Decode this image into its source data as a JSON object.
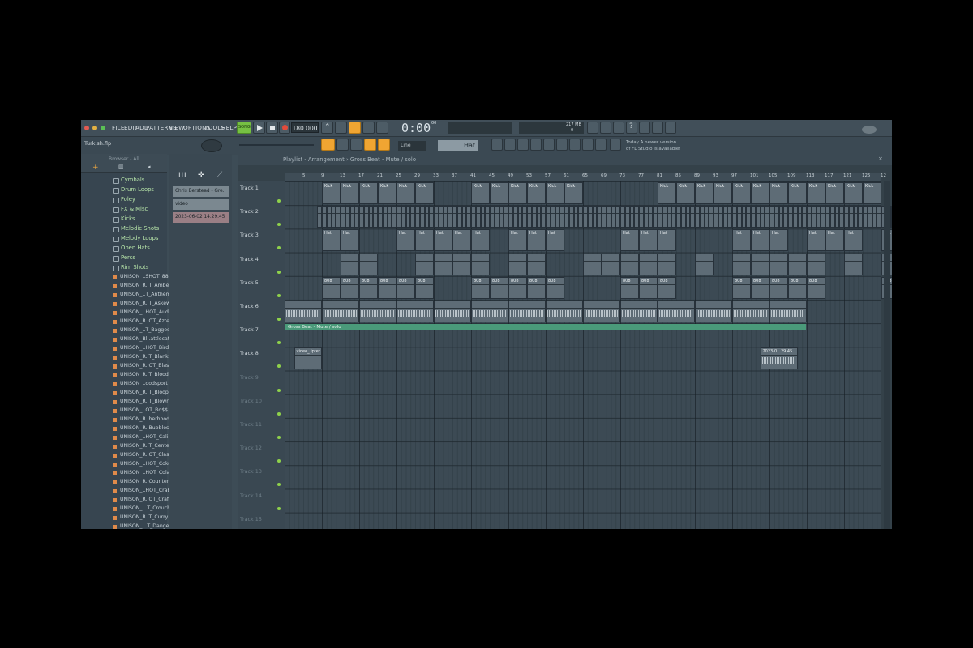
{
  "window": {
    "filename": "Turkish.flp"
  },
  "menu": [
    "FILE",
    "EDIT",
    "ADD",
    "PATTERNS",
    "VIEW",
    "OPTIONS",
    "TOOLS",
    "HELP"
  ],
  "transport": {
    "mode": "SONG",
    "tempo": "180.000",
    "time": "0:00",
    "time_small": "00",
    "memory": "217 MB",
    "cpu": "0"
  },
  "toolbar2": {
    "snap": "Line",
    "pattern": "Hat"
  },
  "news": {
    "line1": "Today  A newer version",
    "line2": "of FL Studio is available!"
  },
  "browser": {
    "label": "Browser - All",
    "folders": [
      "Cymbals",
      "Drum Loops",
      "Foley",
      "FX & Misc",
      "Kicks",
      "Melodic Shots",
      "Melody Loops",
      "Open Hats",
      "Percs",
      "Rim Shots"
    ],
    "files": [
      "UNISON_..SHOT_88",
      "UNISON_R..T_Amber",
      "UNISON_..T_Anthem",
      "UNISON_R..T_Askew",
      "UNISON_..HOT_Audi",
      "UNISON_R..OT_Aztec",
      "UNISON_..T_Bagged",
      "UNISON_Bl..attlecat",
      "UNISON_..HOT_Bird",
      "UNISON_R..T_Blank",
      "UNISON_R..OT_Blast",
      "UNISON_R..T_Blood",
      "UNISON_..oodsport",
      "UNISON_R..T_Bloop",
      "UNISON_R..T_Blown",
      "UNISON_..OT_Bo$$",
      "UNISON_R..herhood",
      "UNISON_R..Bubbles",
      "UNISON_..HOT_Cali",
      "UNISON_R..T_Center",
      "UNISON_R..OT_Class",
      "UNISON_..HOT_Coke",
      "UNISON_..HOT_Cola",
      "UNISON_R..Counters",
      "UNISON_..HOT_Crab",
      "UNISON_R..OT_Craft",
      "UNISON_...T_Crouch",
      "UNISON_R..T_Curry",
      "UNISON_...T_Danger"
    ]
  },
  "channels": [
    "Chris Berstead - Gre..",
    "video",
    "2023-06-02 14.29.45"
  ],
  "playlist": {
    "breadcrumb": "Playlist - Arrangement › Gross Beat - Mute / solo",
    "ruler": [
      "5",
      "9",
      "13",
      "17",
      "21",
      "25",
      "29",
      "33",
      "37",
      "41",
      "45",
      "49",
      "53",
      "57",
      "61",
      "65",
      "69",
      "73",
      "77",
      "81",
      "85",
      "89",
      "93",
      "97",
      "101",
      "105",
      "109",
      "113",
      "117",
      "121",
      "125",
      "12"
    ],
    "tracks": [
      "Track 1",
      "Track 2",
      "Track 3",
      "Track 4",
      "Track 5",
      "Track 6",
      "Track 7",
      "Track 8",
      "Track 9",
      "Track 10",
      "Track 11",
      "Track 12",
      "Track 13",
      "Track 14",
      "Track 15"
    ],
    "clip_labels": {
      "kick": "Kick",
      "hat": "Hat",
      "bass": "808"
    },
    "automation_label": "Gross Beat - Mute / solo",
    "video_clip": "video_.ipter",
    "audio_clip": "2023-0...29.45"
  },
  "colors": {
    "accent": "#f0a532",
    "play_green": "#76c043",
    "automation": "#4a9a7a",
    "panel": "#3d4c56"
  }
}
